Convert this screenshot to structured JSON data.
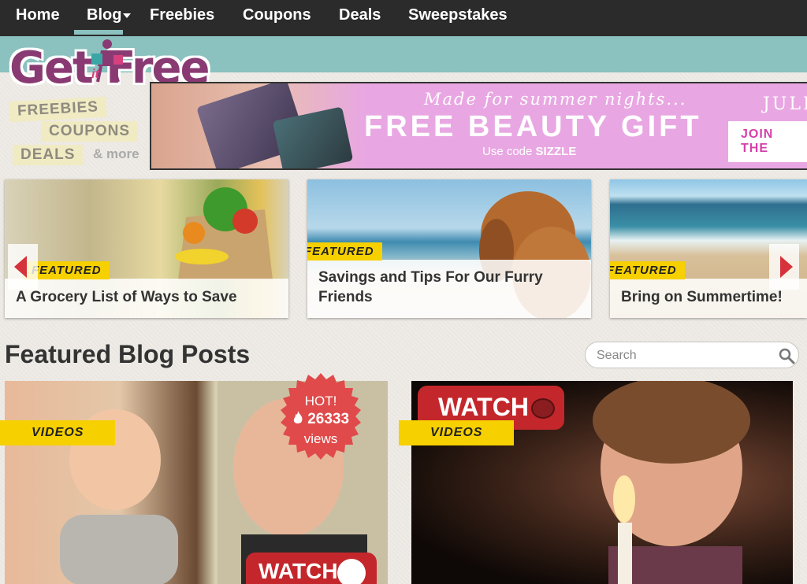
{
  "nav": {
    "items": [
      "Home",
      "Blog",
      "Freebies",
      "Coupons",
      "Deals",
      "Sweepstakes"
    ],
    "active": "Blog"
  },
  "logo": {
    "main": "Get Free",
    "it": "it"
  },
  "tags": {
    "freebies": "FREEBIES",
    "coupons": "COUPONS",
    "deals": "DEALS",
    "more": "& more"
  },
  "ad": {
    "line1": "Made for summer nights...",
    "line2": "FREE BEAUTY GIFT",
    "line3_prefix": "Use code",
    "code": "SIZZLE",
    "brand": "JULEP",
    "join": "JOIN THE"
  },
  "carousel": {
    "cards": [
      {
        "tag": "FEATURED",
        "title": "A Grocery List of Ways to Save"
      },
      {
        "tag": "FEATURED",
        "title": "Savings and Tips For Our Furry Friends"
      },
      {
        "tag": "FEATURED",
        "title": "Bring on Summertime!"
      }
    ]
  },
  "featured": {
    "title": "Featured Blog Posts",
    "search_placeholder": "Search",
    "posts": [
      {
        "tag": "VIDEOS",
        "hot_label": "HOT!",
        "hot_count": "26333",
        "hot_unit": "views",
        "watch": "WATCH"
      },
      {
        "tag": "VIDEOS",
        "watch": "WATCH"
      }
    ]
  },
  "colors": {
    "nav_bg": "#2b2b2b",
    "teal": "#8bc1bf",
    "tag_yellow": "#f7d000",
    "hot_red": "#e04a4a",
    "logo_purple": "#8a3a72"
  }
}
